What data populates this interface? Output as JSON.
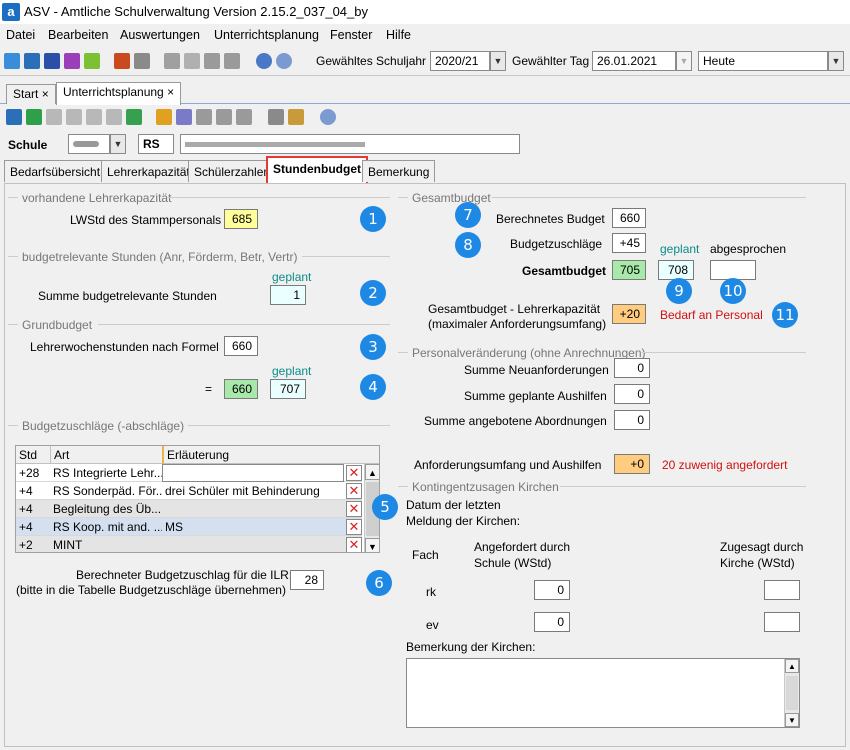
{
  "app": {
    "title": "ASV - Amtliche Schulverwaltung Version 2.15.2_037_04_by",
    "icon_letter": "a"
  },
  "menu": [
    "Datei",
    "Bearbeiten",
    "Auswertungen",
    "Unterrichtsplanung",
    "Fenster",
    "Hilfe"
  ],
  "topbar": {
    "schuljahr_label": "Gewähltes Schuljahr",
    "schuljahr": "2020/21",
    "tag_label": "Gewählter Tag",
    "tag": "26.01.2021",
    "heute": "Heute"
  },
  "doc_tabs": [
    {
      "label": "Start",
      "close": "×"
    },
    {
      "label": "Unterrichtsplanung",
      "close": "×"
    }
  ],
  "school": {
    "label": "Schule",
    "type": "RS"
  },
  "subtabs": [
    "Bedarfsübersicht",
    "Lehrerkapazität",
    "Schülerzahlen",
    "Stundenbudget",
    "Bemerkung"
  ],
  "left": {
    "sec1": "vorhandene Lehrerkapazität",
    "lwstd_label": "LWStd des Stammpersonals",
    "lwstd": "685",
    "sec2": "budgetrelevante Stunden (Anr, Förderm, Betr, Vertr)",
    "geplant": "geplant",
    "summe_label": "Summe budgetrelevante Stunden",
    "summe": "1",
    "sec3": "Grundbudget",
    "lws_formel_label": "Lehrerwochenstunden nach Formel",
    "lws_formel": "660",
    "eq": "=",
    "grund_ist": "660",
    "grund_geplant": "707",
    "sec4": "Budgetzuschläge (-abschläge)",
    "table_headers": [
      "Std",
      "Art",
      "Erläuterung"
    ],
    "rows": [
      {
        "std": "+28",
        "art": "RS Integrierte Lehr...",
        "erl": ""
      },
      {
        "std": "+4",
        "art": "RS Sonderpäd. För...",
        "erl": "drei Schüler mit Behinderung"
      },
      {
        "std": "+4",
        "art": "Begleitung des Üb...",
        "erl": ""
      },
      {
        "std": "+4",
        "art": "RS Koop. mit and. ...",
        "erl": "MS"
      },
      {
        "std": "+2",
        "art": "MINT",
        "erl": ""
      }
    ],
    "ilr_label1": "Berechneter Budgetzuschlag für die ILR:",
    "ilr_label2": "(bitte in die Tabelle Budgetzuschläge übernehmen)",
    "ilr": "28"
  },
  "right": {
    "sec1": "Gesamtbudget",
    "berechnet_label": "Berechnetes Budget",
    "berechnet": "660",
    "zuschlaege_label": "Budgetzuschläge",
    "zuschlaege": "+45",
    "geplant": "geplant",
    "abgesprochen": "abgesprochen",
    "gesamt_label": "Gesamtbudget",
    "gesamt": "705",
    "gesamt_geplant": "708",
    "gesamt_abgesprochen": "",
    "diff_label1": "Gesamtbudget - Lehrerkapazität",
    "diff_label2": "(maximaler Anforderungsumfang)",
    "diff": "+20",
    "bedarf": "Bedarf an Personal",
    "sec2": "Personalveränderung (ohne Anrechnungen)",
    "neu_label": "Summe Neuanforderungen",
    "neu": "0",
    "aush_label": "Summe geplante Aushilfen",
    "aush": "0",
    "abord_label": "Summe angebotene Abordnungen",
    "abord": "0",
    "anf_label": "Anforderungsumfang und Aushilfen",
    "anf": "+0",
    "zuwenig": "20 zuwenig angefordert",
    "sec3": "Kontingentzusagen Kirchen",
    "datum1": "Datum der letzten",
    "datum2": "Meldung der Kirchen:",
    "fach": "Fach",
    "angef1": "Angefordert durch",
    "angef2": "Schule (WStd)",
    "zuges1": "Zugesagt durch",
    "zuges2": "Kirche (WStd)",
    "rk": "rk",
    "rk_val": "0",
    "ev": "ev",
    "ev_val": "0",
    "bem_label": "Bemerkung der Kirchen:"
  },
  "badges": [
    "1",
    "2",
    "3",
    "4",
    "5",
    "6",
    "7",
    "8",
    "9",
    "10",
    "11"
  ],
  "colors": {
    "accent": "#1e88e5",
    "highlight_red": "#e53935"
  }
}
